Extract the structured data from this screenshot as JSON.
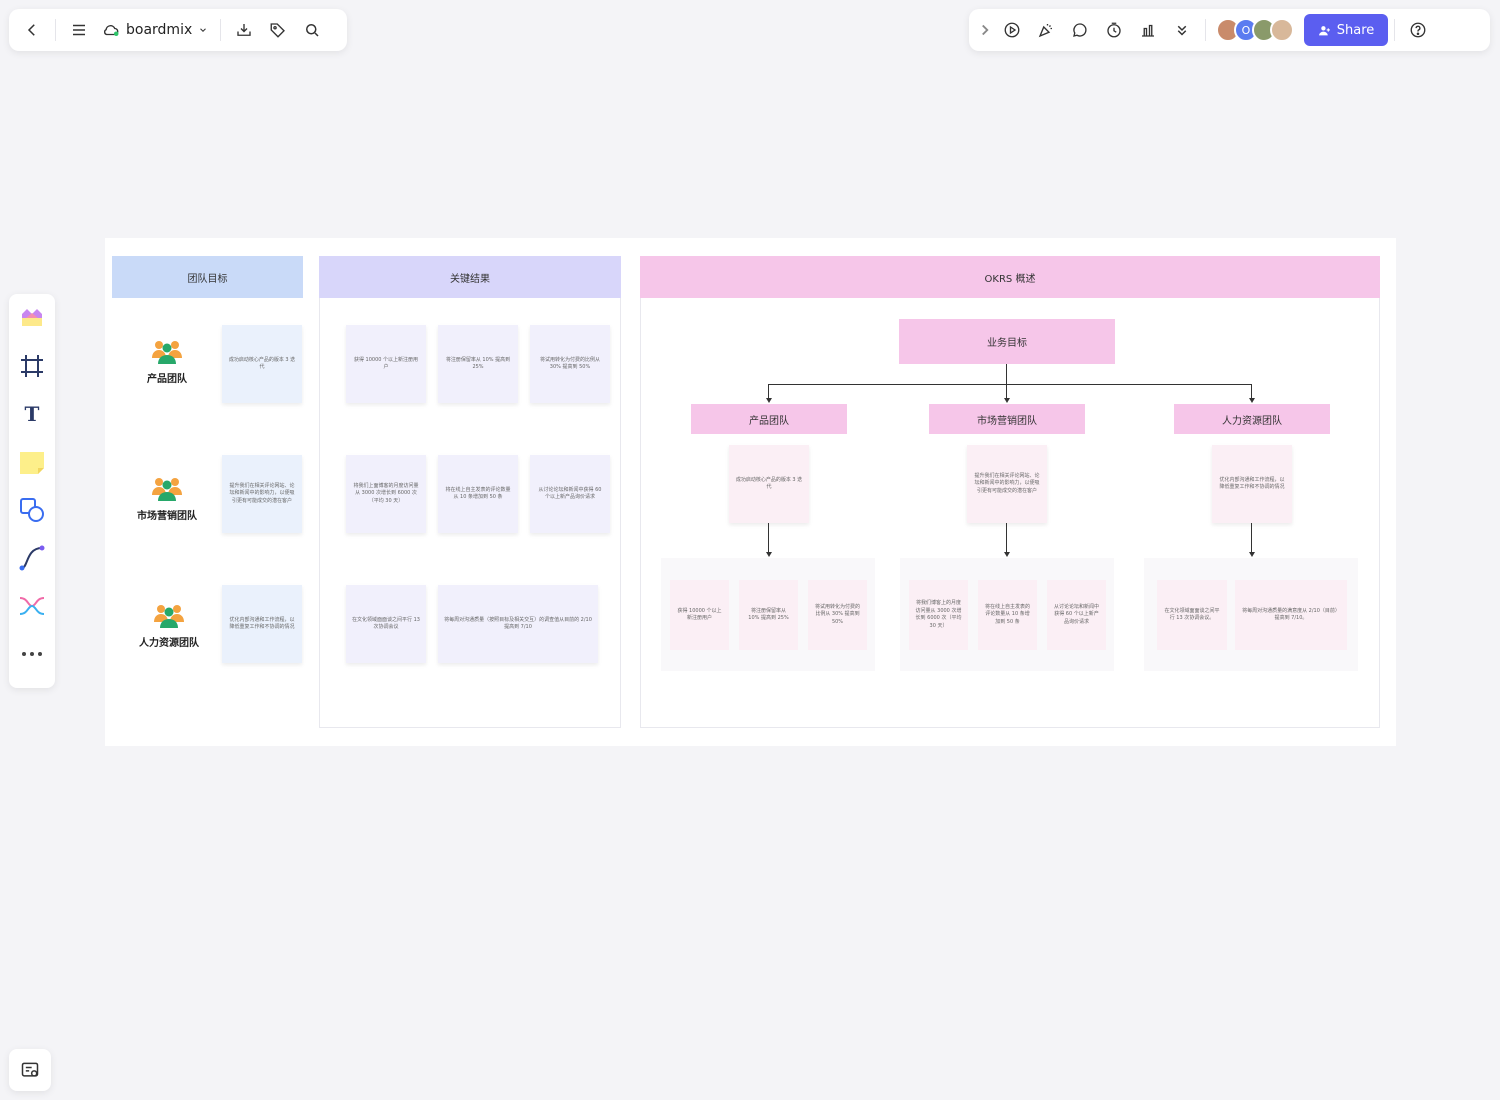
{
  "app": {
    "name": "boardmix",
    "share_label": "Share"
  },
  "avatars": [
    {
      "initial": "",
      "color": "#c98b6b"
    },
    {
      "initial": "O",
      "color": "#5b7cf0"
    },
    {
      "initial": "",
      "color": "#8a9a6a"
    },
    {
      "initial": "",
      "color": "#d8b89a"
    }
  ],
  "board": {
    "headers": {
      "team_goals": "团队目标",
      "key_results": "关键结果",
      "okrs": "OKRS 概述"
    },
    "teams": [
      {
        "name": "产品团队",
        "goal": "成功启动核心产品的版本 3 迭代",
        "results": [
          "获得 10000 个以上新注册用户",
          "将注册保留率从 10% 提高到 25%",
          "将试用转化为付费的比例从 30% 提高到 50%"
        ]
      },
      {
        "name": "市场营销团队",
        "goal": "提升我们在相关评论网站、论坛和新闻中的影响力，以便吸引更有可能成交的潜在客户",
        "results": [
          "将我们上面博客的月度访问量从 3000 次增长到 6000 次（平均 30 天）",
          "将在线上自主发表的评论数量从 10 条增加到 50 条",
          "从讨论论坛和新闻中获得 60 个以上新产品询价请求"
        ]
      },
      {
        "name": "人力资源团队",
        "goal": "优化内部沟通和工作流程，以降低重复工作和不协调的情况",
        "results": [
          "在文化领域面面谈之间平行 13 次协调会议",
          "将每周对沟通质量（按照目标及相关交互）的调查值从目前的 2/10 提高到 7/10"
        ]
      }
    ],
    "okr": {
      "root": "业务目标",
      "branches": [
        {
          "name": "产品团队",
          "goal": "成功启动核心产品的版本 3 迭代",
          "results": [
            "获得 10000 个以上新注册用户",
            "将注册保留率从 10% 提高到 25%",
            "将试用转化为付费的比例从 30% 提高到 50%"
          ]
        },
        {
          "name": "市场营销团队",
          "goal": "提升我们在相关评论网站、论坛和新闻中的影响力，以便吸引更有可能成交的潜在客户",
          "results": [
            "将我们博客上的月度访问量从 3000 次增长到 6000 次（平均 30 天）",
            "将在线上自主发表的评论数量从 10 条增加到 50 条",
            "从讨论论坛和新闻中获得 60 个以上新产品询价请求"
          ]
        },
        {
          "name": "人力资源团队",
          "goal": "优化内部沟通和工作流程，以降低重复工作和不协调的情况",
          "results": [
            "在文化领域面面谈之间平行 13 次协调会议。",
            "将每周对沟通质量的满意度从 2/10（目前）提高到 7/10。"
          ]
        }
      ]
    }
  },
  "colors": {
    "header_blue": "#c9daf8",
    "header_lavender": "#d8d6fa",
    "header_pink": "#f6c6e9",
    "accent": "#5b5ef0"
  }
}
